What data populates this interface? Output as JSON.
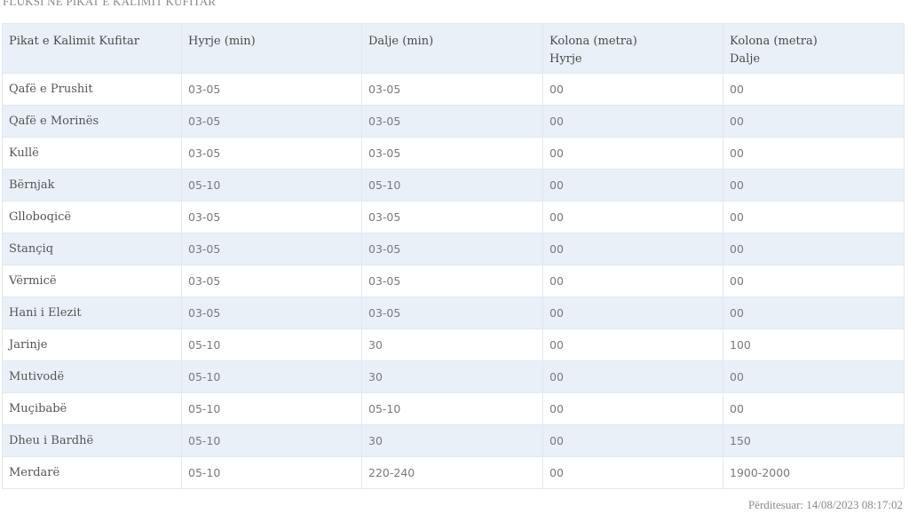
{
  "title": "FLUKSI NË PIKAT E KALIMIT KUFITAR",
  "columns": [
    {
      "line1": "Pikat e Kalimit Kufitar",
      "line2": ""
    },
    {
      "line1": "Hyrje (min)",
      "line2": ""
    },
    {
      "line1": "Dalje (min)",
      "line2": ""
    },
    {
      "line1": "Kolona (metra)",
      "line2": "Hyrje"
    },
    {
      "line1": "Kolona (metra)",
      "line2": "Dalje"
    }
  ],
  "rows": [
    [
      "Qafë e Prushit",
      "03-05",
      "03-05",
      "00",
      "00"
    ],
    [
      "Qafë e Morinës",
      "03-05",
      "03-05",
      "00",
      "00"
    ],
    [
      "Kullë",
      "03-05",
      "03-05",
      "00",
      "00"
    ],
    [
      "Bërnjak",
      "05-10",
      "05-10",
      "00",
      "00"
    ],
    [
      "Glloboqicë",
      "03-05",
      "03-05",
      "00",
      "00"
    ],
    [
      "Stançiq",
      "03-05",
      "03-05",
      "00",
      "00"
    ],
    [
      "Vërmicë",
      "03-05",
      "03-05",
      "00",
      "00"
    ],
    [
      "Hani i Elezit",
      "03-05",
      "03-05",
      "00",
      "00"
    ],
    [
      "Jarinje",
      "05-10",
      "30",
      "00",
      "100"
    ],
    [
      "Mutivodë",
      "05-10",
      "30",
      "00",
      "00"
    ],
    [
      "Muçibabë",
      "05-10",
      "05-10",
      "00",
      "00"
    ],
    [
      "Dheu i Bardhë",
      "05-10",
      "30",
      "00",
      "150"
    ],
    [
      "Merdarë",
      "05-10",
      "220-240",
      "00",
      "1900-2000"
    ]
  ],
  "updated": "Përditesuar: 14/08/2023 08:17:02",
  "colors": {
    "header_bg": "#e9f0f8",
    "stripe_bg": "#e9f0f8",
    "border": "#e3e8ee",
    "text": "#7a7a7a"
  }
}
